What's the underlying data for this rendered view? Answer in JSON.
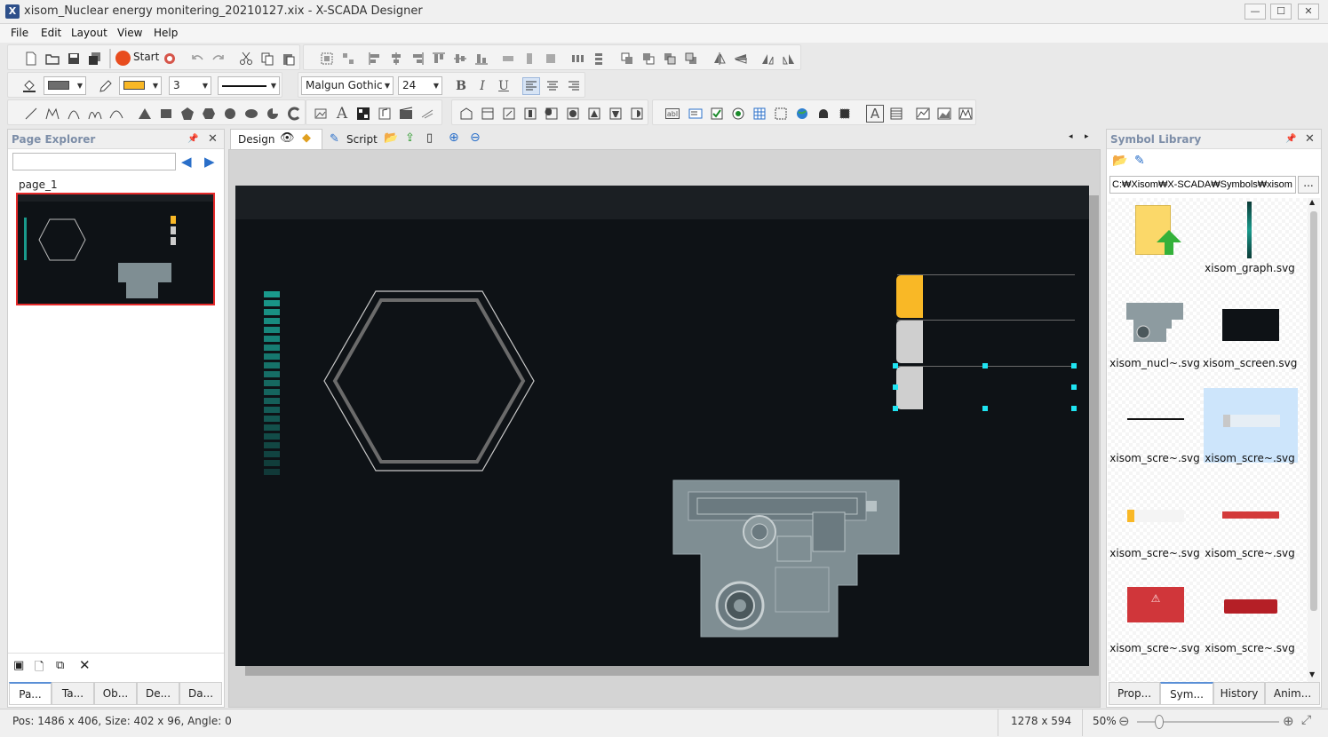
{
  "window": {
    "title": "xisom_Nuclear energy monitering_20210127.xix - X-SCADA Designer",
    "minimize": "—",
    "maximize": "☐",
    "close": "✕"
  },
  "menu": [
    "File",
    "Edit",
    "Layout",
    "View",
    "Help"
  ],
  "toolbar": {
    "start_label": "Start",
    "line_width": "3",
    "font_family": "Malgun Gothic",
    "font_size": "24",
    "bold": "B",
    "italic": "I",
    "underline": "U",
    "fill_color": "#6d6d6d",
    "stroke_color": "#f9b826"
  },
  "page_explorer": {
    "title": "Page Explorer",
    "search_value": "",
    "page_label": "page_1",
    "tabs": [
      "Pa...",
      "Ta...",
      "Ob...",
      "De...",
      "Da..."
    ]
  },
  "editor": {
    "tabs": [
      "Design",
      "Script"
    ]
  },
  "canvas": {
    "background": "#0e1216",
    "accent": "#f9b826",
    "teal": "#1a9a8c"
  },
  "symbol_library": {
    "title": "Symbol Library",
    "path_value": "C:₩Xisom₩X-SCADA₩Symbols₩xisom",
    "browse_label": "...",
    "items": [
      "",
      "xisom_graph.svg",
      "xisom_nucl~.svg",
      "xisom_screen.svg",
      "xisom_scre~.svg",
      "xisom_scre~.svg",
      "xisom_scre~.svg",
      "xisom_scre~.svg",
      "xisom_scre~.svg",
      "xisom_scre~.svg"
    ],
    "tabs": [
      "Prop...",
      "Sym...",
      "History",
      "Anim..."
    ]
  },
  "status": {
    "position": "Pos: 1486 x 406, Size: 402 x 96, Angle: 0",
    "canvas_size": "1278 x 594",
    "zoom": "50%",
    "zoom_level": 0.5
  }
}
